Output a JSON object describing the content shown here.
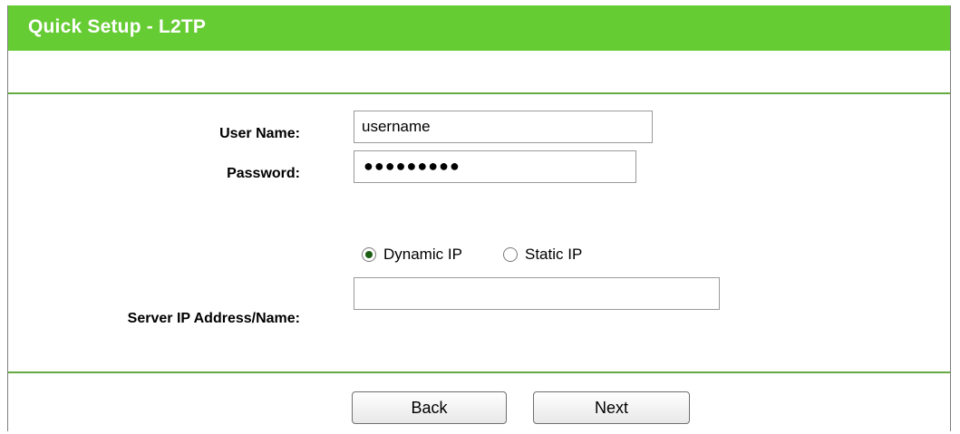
{
  "header": {
    "title": "Quick Setup - L2TP"
  },
  "form": {
    "user_name_label": "User Name:",
    "user_name_value": "username",
    "password_label": "Password:",
    "password_value": "●●●●●●●●●",
    "ip_mode": {
      "dynamic_label": "Dynamic IP",
      "static_label": "Static IP",
      "selected": "Dynamic IP"
    },
    "server_label": "Server IP Address/Name:",
    "server_value": ""
  },
  "footer": {
    "back_label": "Back",
    "next_label": "Next"
  },
  "colors": {
    "title_bar": "#66cc33",
    "divider": "#66aa44"
  }
}
